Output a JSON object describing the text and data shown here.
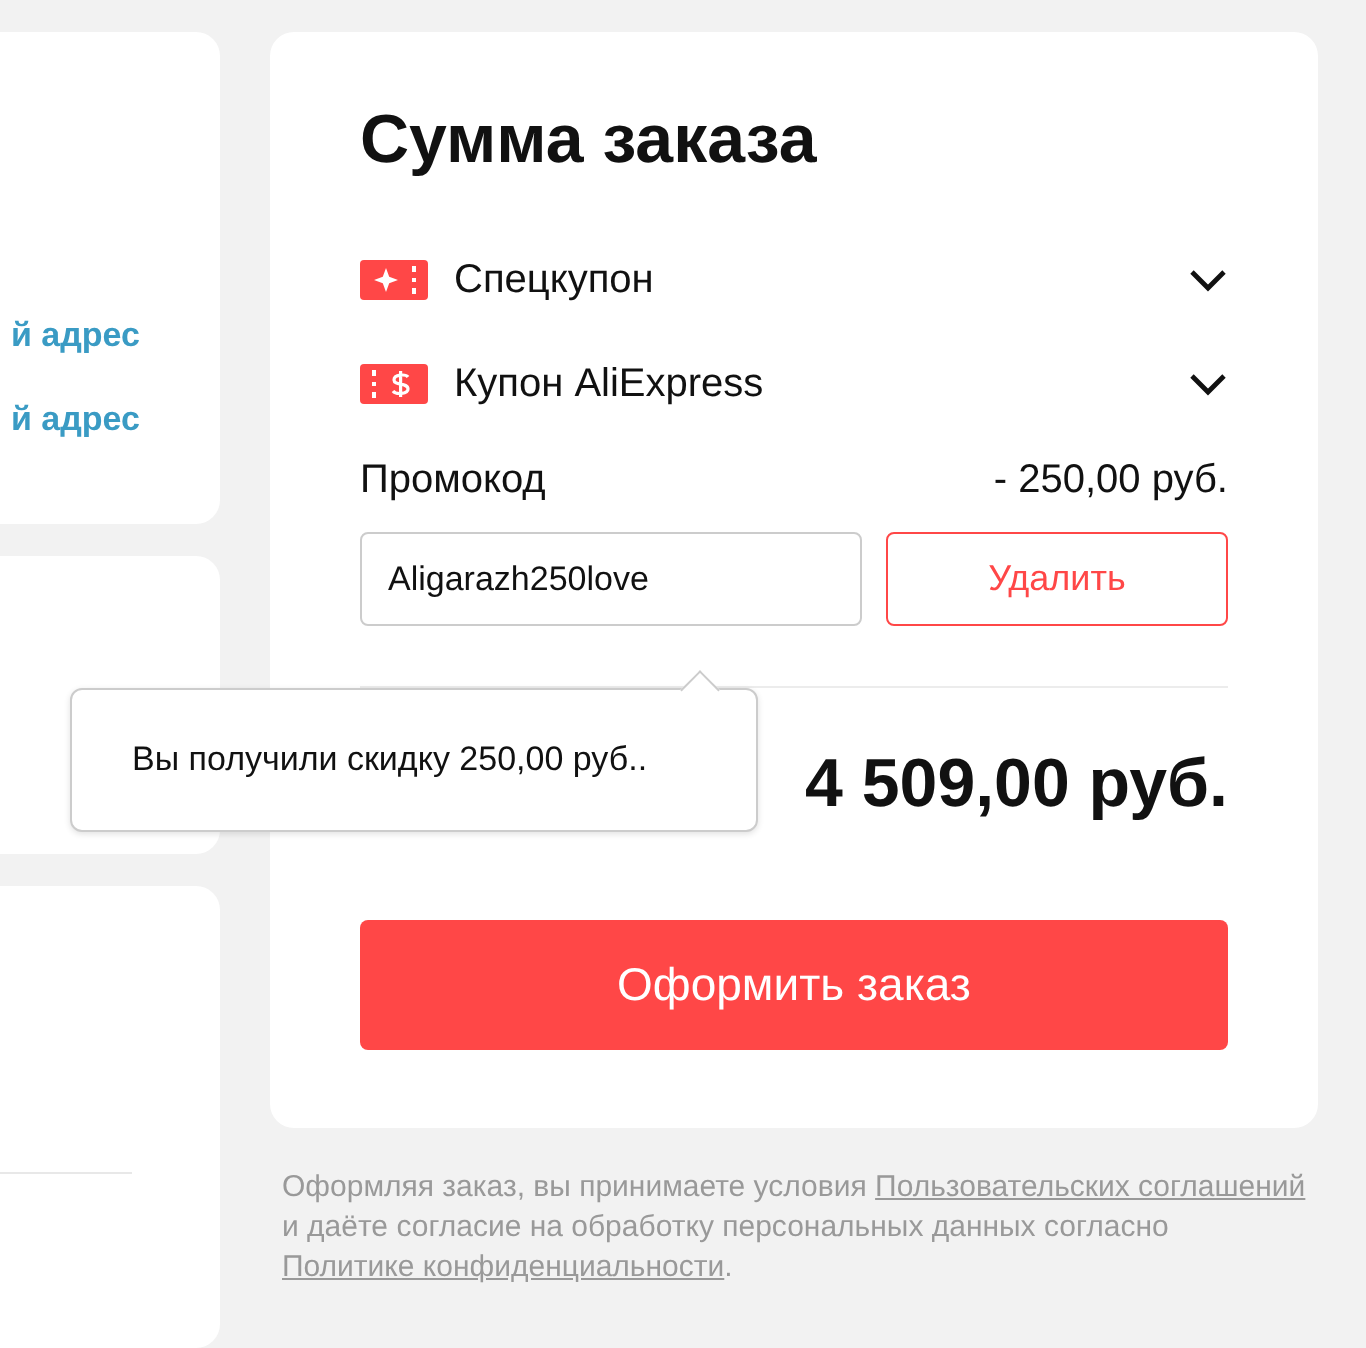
{
  "address_links": [
    "й адрес",
    "й адрес"
  ],
  "order_summary": {
    "title": "Сумма заказа",
    "coupons": [
      {
        "kind": "special",
        "label": "Спецкупон",
        "expanded": false
      },
      {
        "kind": "store",
        "label": "Купон AliExpress",
        "expanded": false
      }
    ],
    "promo": {
      "label": "Промокод",
      "discount": "- 250,00 руб.",
      "value": "Aligarazh250love",
      "button": "Удалить"
    },
    "tooltip": "Вы получили скидку 250,00 руб..",
    "total": "4 509,00 руб.",
    "checkout_button": "Оформить заказ"
  },
  "legal": [
    {
      "kind": "text",
      "text": "Оформляя заказ, вы принимаете условия "
    },
    {
      "kind": "link",
      "text": "Пользовательских соглашений"
    },
    {
      "kind": "text",
      "text": " и даёте согласие на обработку персональных данных согласно "
    },
    {
      "kind": "link",
      "text": "Политике конфиденциальности"
    },
    {
      "kind": "text",
      "text": "."
    }
  ]
}
